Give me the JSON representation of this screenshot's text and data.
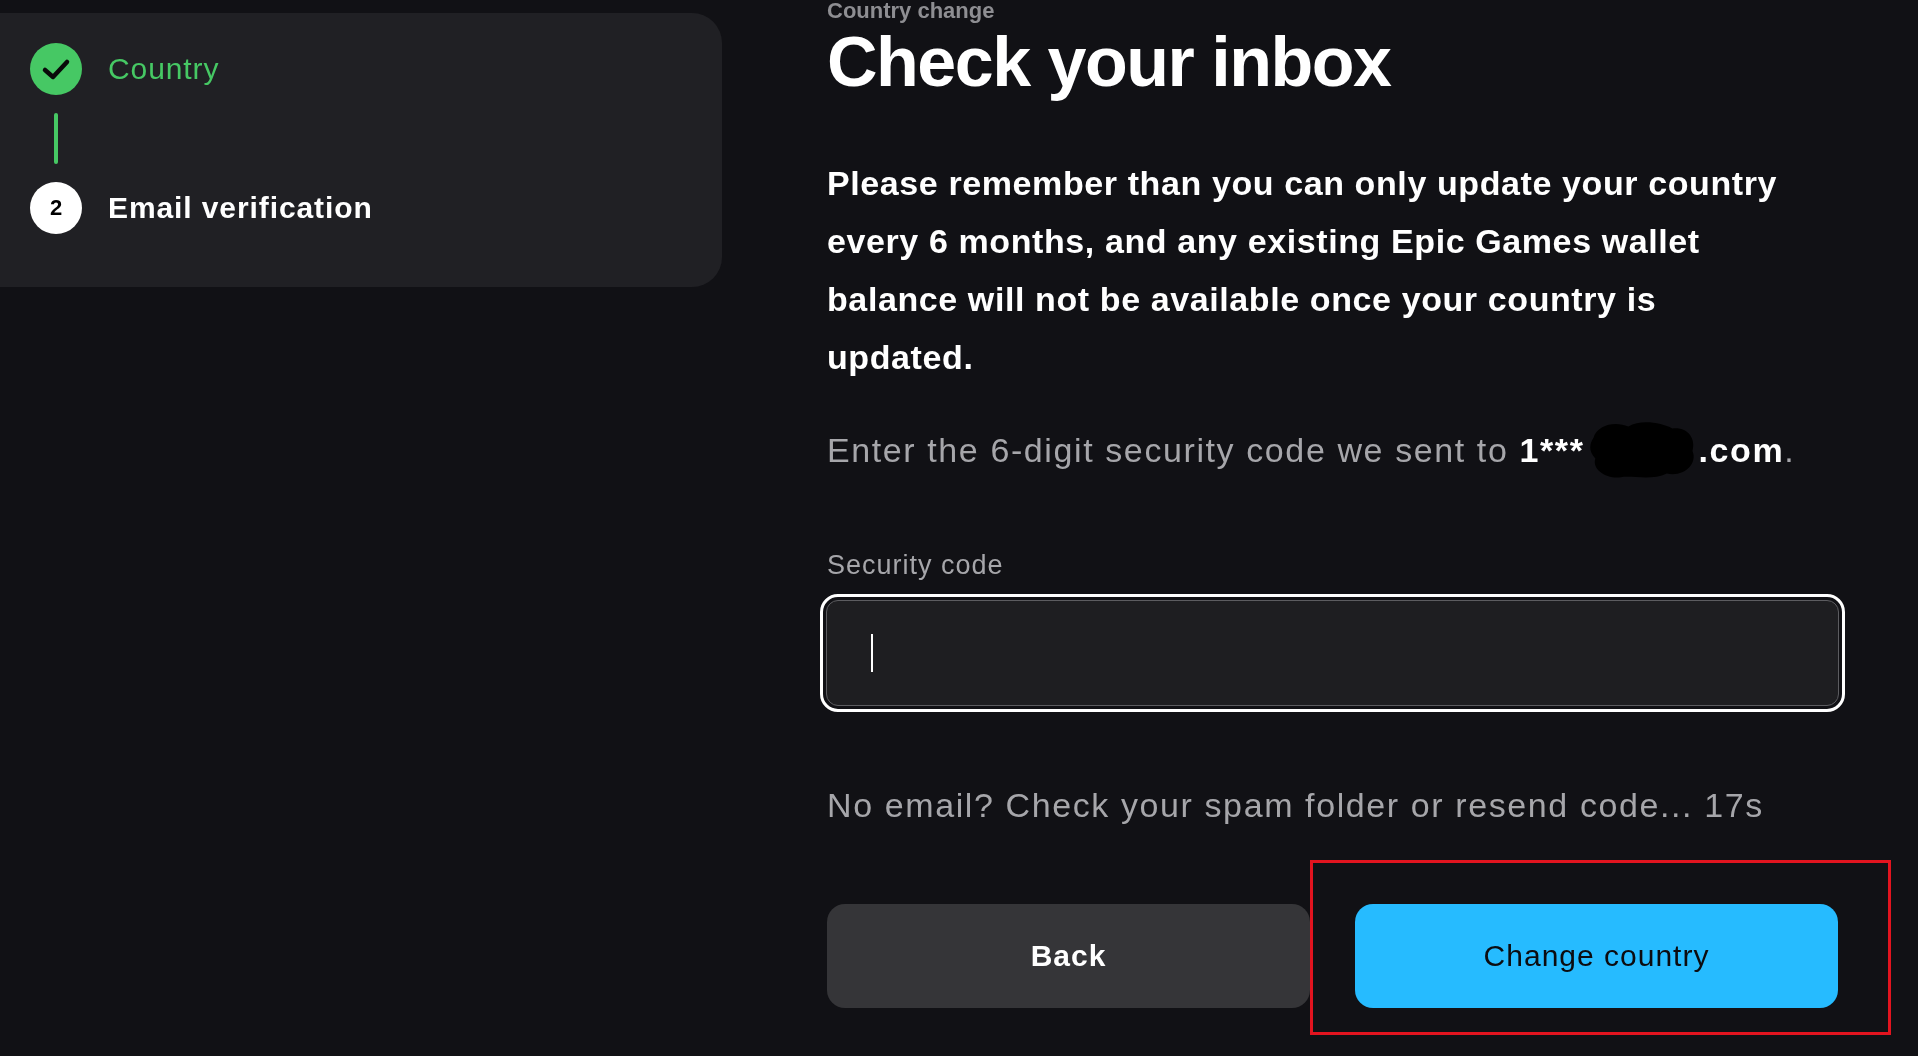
{
  "sidebar": {
    "steps": [
      {
        "label": "Country",
        "kind": "done"
      },
      {
        "label": "Email verification",
        "kind": "current",
        "number": "2"
      }
    ]
  },
  "main": {
    "eyebrow": "Country change",
    "title": "Check your inbox",
    "notice": "Please remember than you can only update your country every 6 months, and any existing Epic Games wallet balance will not be available once your country is updated.",
    "code_prompt": {
      "text": "Enter the 6-digit security code we sent to",
      "email_start": "1***",
      "email_end": ".com",
      "end": "."
    },
    "security_code": {
      "label": "Security code",
      "focused": true
    },
    "resend_note": "No email? Check your spam folder or resend code... 17s",
    "buttons": [
      {
        "label": "Back",
        "kind": "secondary"
      },
      {
        "label": "Change country",
        "kind": "primary",
        "highlighted": true
      }
    ]
  }
}
